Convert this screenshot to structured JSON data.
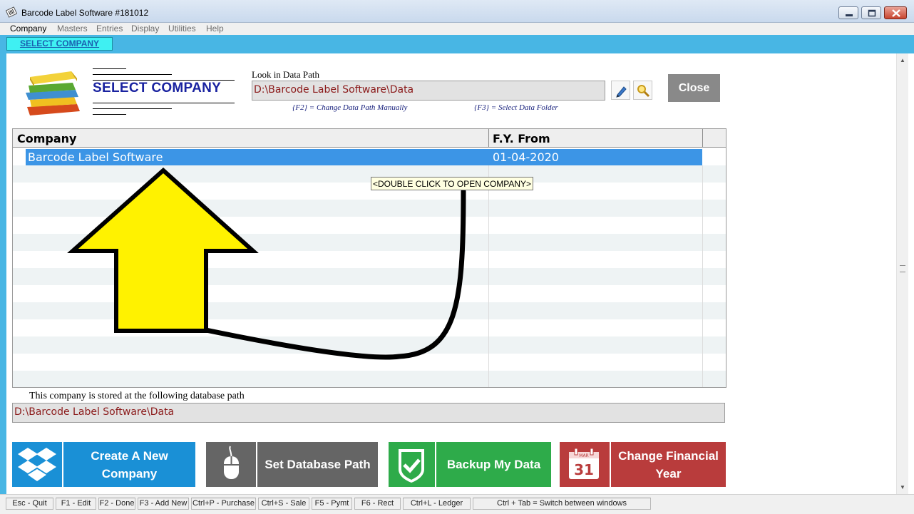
{
  "window": {
    "title": "Barcode Label Software #181012"
  },
  "menu": [
    "Company",
    "Masters",
    "Entries",
    "Display",
    "Utilities",
    "Help"
  ],
  "tab": {
    "label": "SELECT COMPANY"
  },
  "header": {
    "title": "SELECT COMPANY",
    "path_label": "Look in Data Path",
    "data_path": "D:\\Barcode Label Software\\Data",
    "hint_f2": "{F2} = Change Data Path Manually",
    "hint_f3": "{F3} = Select Data Folder",
    "close_label": "Close"
  },
  "grid": {
    "columns": [
      "Company",
      "F.Y.  From"
    ],
    "rows": [
      {
        "company": "Barcode Label Software",
        "fy_from": "01-04-2020"
      }
    ],
    "tooltip": "<DOUBLE CLICK TO OPEN COMPANY>"
  },
  "stored": {
    "label": "This company is stored at the following database path",
    "path": "D:\\Barcode Label Software\\Data"
  },
  "actions": {
    "create_line1": "Create A New",
    "create_line2": "Company",
    "set_path": "Set Database Path",
    "backup": "Backup My Data",
    "change_fy_line1": "Change Financial",
    "change_fy_line2": "Year",
    "calendar_day": "31",
    "calendar_month": "MAR"
  },
  "statusbar": [
    "Esc - Quit",
    "F1 - Edit",
    "F2 - Done",
    "F3 - Add New",
    "Ctrl+P - Purchase",
    "Ctrl+S - Sale",
    "F5 - Pymt",
    "F6 - Rect",
    "Ctrl+L - Ledger",
    "Ctrl + Tab = Switch between windows"
  ],
  "colors": {
    "accent_blue": "#48b6e4",
    "create_button": "#1a90d6",
    "set_path_button": "#656565",
    "backup_button": "#2eab4a",
    "change_fy_button": "#b93c3c",
    "selection": "#3c95e6",
    "annotation_arrow": "#fff200"
  }
}
